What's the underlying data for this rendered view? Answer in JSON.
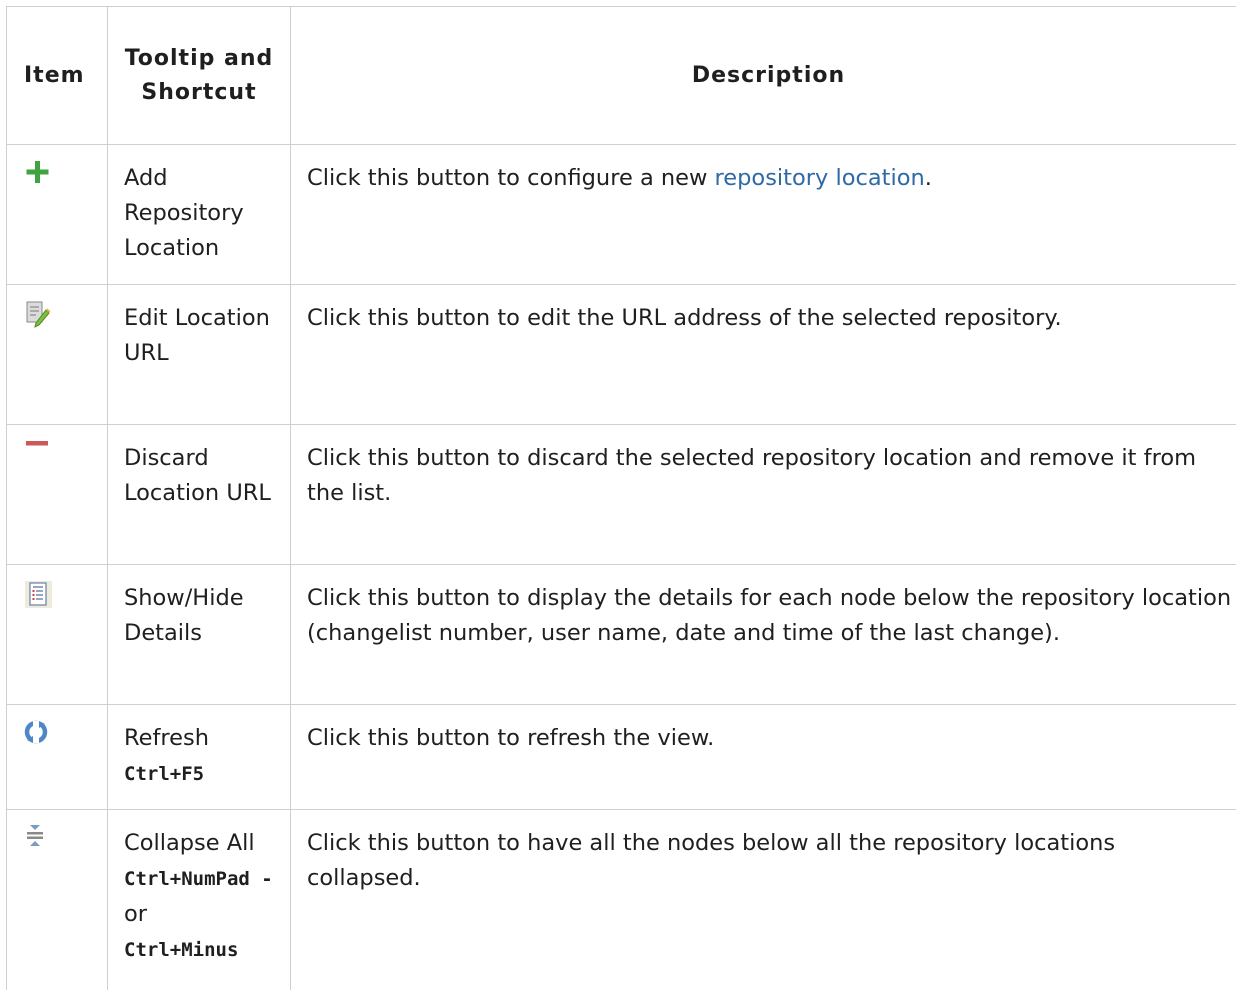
{
  "table": {
    "headers": {
      "item": "Item",
      "tooltip": "Tooltip and Shortcut",
      "description": "Description"
    },
    "rows": [
      {
        "icon": "add-icon",
        "tooltip": "Add Repository Location",
        "desc_before": "Click this button to configure a new ",
        "desc_link": "repository location",
        "desc_after": "."
      },
      {
        "icon": "edit-icon",
        "tooltip": "Edit Location URL",
        "desc": "Click this button to edit the URL address of the selected repository."
      },
      {
        "icon": "remove-icon",
        "tooltip": "Discard Location URL",
        "desc": "Click this button to discard the selected repository location and remove it from the list."
      },
      {
        "icon": "details-icon",
        "tooltip": "Show/Hide Details",
        "desc": "Click this button to display the details for each node below the repository location (changelist number, user name, date and time of the last change)."
      },
      {
        "icon": "refresh-icon",
        "tooltip": "Refresh",
        "shortcut": "Ctrl+F5",
        "desc": "Click this button to refresh the view."
      },
      {
        "icon": "collapse-all-icon",
        "tooltip": "Collapse All",
        "shortcut1": "Ctrl+NumPad -",
        "or_text": "or",
        "shortcut2": "Ctrl+Minus",
        "desc": "Click this button to have all the nodes below all the repository locations collapsed."
      }
    ]
  },
  "colors": {
    "link": "#2f6aa6",
    "add_icon": "#3fa33f",
    "remove_icon": "#c85a5a",
    "border": "#cfcfcf"
  }
}
